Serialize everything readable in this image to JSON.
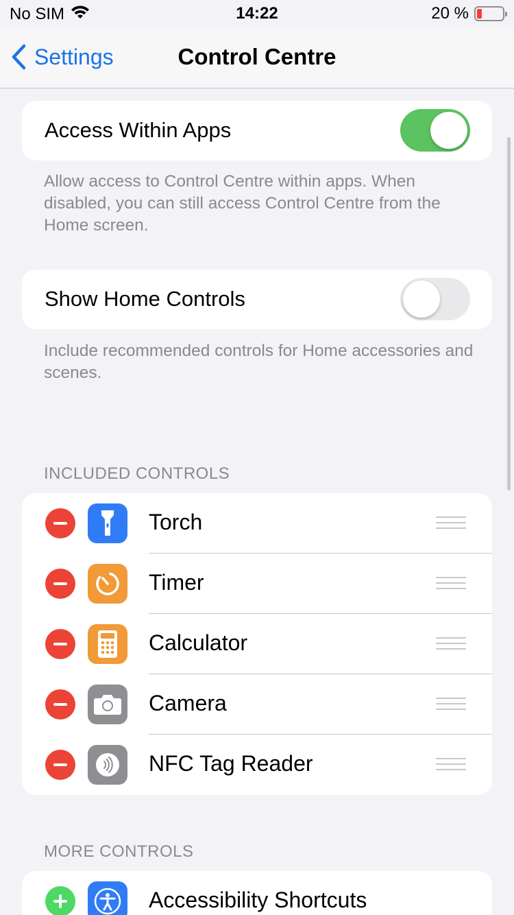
{
  "status_bar": {
    "carrier": "No SIM",
    "time": "14:22",
    "battery_percent": "20 %",
    "battery_level": 0.2
  },
  "nav": {
    "back_label": "Settings",
    "title": "Control Centre"
  },
  "access_within_apps": {
    "label": "Access Within Apps",
    "enabled": true,
    "footer": "Allow access to Control Centre within apps. When disabled, you can still access Control Centre from the Home screen."
  },
  "show_home_controls": {
    "label": "Show Home Controls",
    "enabled": false,
    "footer": "Include recommended controls for Home accessories and scenes."
  },
  "included_controls": {
    "header": "INCLUDED CONTROLS",
    "items": [
      {
        "label": "Torch",
        "icon": "torch-icon",
        "color": "#2f7cf6"
      },
      {
        "label": "Timer",
        "icon": "timer-icon",
        "color": "#f19a37"
      },
      {
        "label": "Calculator",
        "icon": "calculator-icon",
        "color": "#f19a37"
      },
      {
        "label": "Camera",
        "icon": "camera-icon",
        "color": "#8e8e93"
      },
      {
        "label": "NFC Tag Reader",
        "icon": "nfc-icon",
        "color": "#8e8e93"
      }
    ]
  },
  "more_controls": {
    "header": "MORE CONTROLS",
    "items": [
      {
        "label": "Accessibility Shortcuts",
        "icon": "accessibility-icon",
        "color": "#2f7cf6"
      }
    ]
  },
  "colors": {
    "accent": "#1a73e8",
    "toggle_on": "#5bc35f",
    "remove": "#eb4436",
    "add": "#4cd964"
  }
}
